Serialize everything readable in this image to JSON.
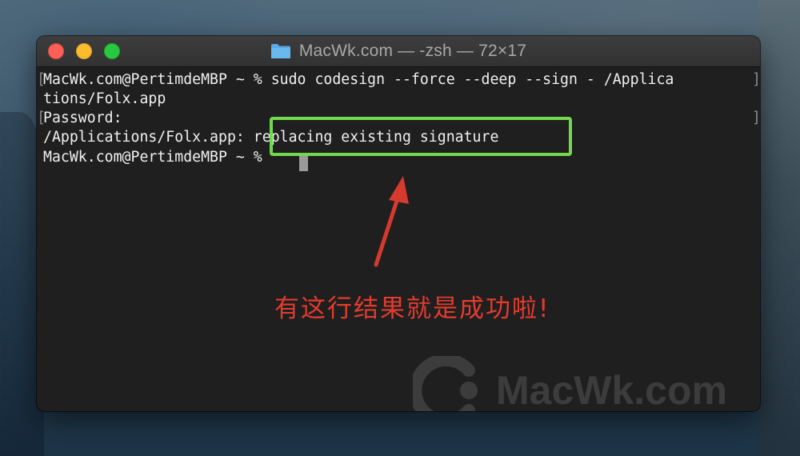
{
  "window": {
    "title": "MacWk.com — -zsh — 72×17",
    "folder_icon": "folder-icon"
  },
  "terminal": {
    "lines": [
      "MacWk.com@PertimdeMBP ~ % sudo codesign --force --deep --sign - /Applica",
      "tions/Folx.app",
      "Password:",
      "/Applications/Folx.app: replacing existing signature",
      "MacWk.com@PertimdeMBP ~ % "
    ],
    "mark_open": "[",
    "mark_close": "]"
  },
  "annotation": {
    "text": "有这行结果就是成功啦!",
    "color": "#e33b2e",
    "highlight_color": "#72d84e"
  },
  "watermark": {
    "text": "MacWk.com"
  },
  "colors": {
    "terminal_bg": "#1f1f1f",
    "titlebar_bg": "#383838",
    "close": "#fc5f57",
    "minimize": "#fdbc2e",
    "maximize": "#28c840"
  }
}
